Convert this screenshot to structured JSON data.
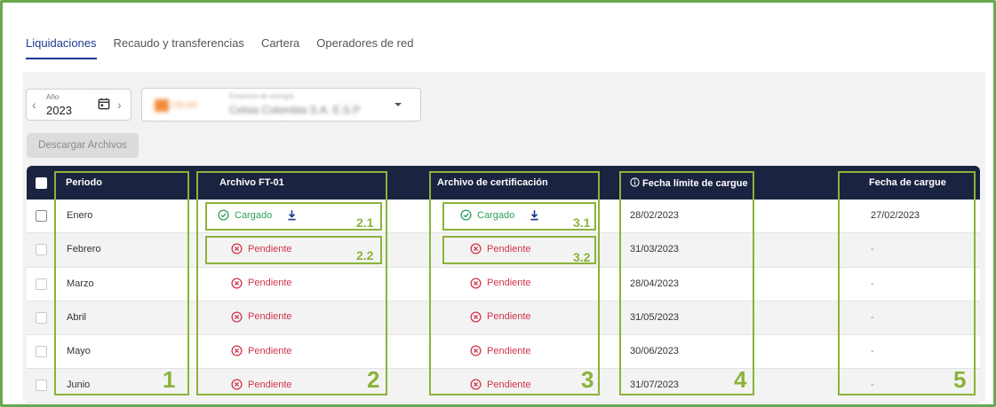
{
  "tabs": [
    {
      "label": "Liquidaciones",
      "active": true
    },
    {
      "label": "Recaudo y transferencias",
      "active": false
    },
    {
      "label": "Cartera",
      "active": false
    },
    {
      "label": "Operadores de red",
      "active": false
    }
  ],
  "filters": {
    "year_label": "Año",
    "year_value": "2023",
    "company_sub_label": "Empresa de energía",
    "company_name": "Celsia Colombia S.A. E.S.P",
    "company_logo_text": "CELSIA"
  },
  "actions": {
    "download_label": "Descargar Archivos"
  },
  "table": {
    "headers": {
      "periodo": "Periodo",
      "archivo_ft01": "Archivo FT-01",
      "archivo_cert": "Archivo de certificación",
      "fecha_limite": "Fecha límite de cargue",
      "fecha_cargue": "Fecha de cargue"
    },
    "rows": [
      {
        "periodo": "Enero",
        "ft01": "Cargado",
        "cert": "Cargado",
        "fecha_limite": "28/02/2023",
        "fecha_cargue": "27/02/2023"
      },
      {
        "periodo": "Febrero",
        "ft01": "Pendiente",
        "cert": "Pendiente",
        "fecha_limite": "31/03/2023",
        "fecha_cargue": "-"
      },
      {
        "periodo": "Marzo",
        "ft01": "Pendiente",
        "cert": "Pendiente",
        "fecha_limite": "28/04/2023",
        "fecha_cargue": "-"
      },
      {
        "periodo": "Abril",
        "ft01": "Pendiente",
        "cert": "Pendiente",
        "fecha_limite": "31/05/2023",
        "fecha_cargue": "-"
      },
      {
        "periodo": "Mayo",
        "ft01": "Pendiente",
        "cert": "Pendiente",
        "fecha_limite": "30/06/2023",
        "fecha_cargue": "-"
      },
      {
        "periodo": "Junio",
        "ft01": "Pendiente",
        "cert": "Pendiente",
        "fecha_limite": "31/07/2023",
        "fecha_cargue": "-"
      }
    ]
  },
  "annotations": {
    "col1": "1",
    "col2": "2",
    "col3": "3",
    "col4": "4",
    "col5": "5",
    "c21": "2.1",
    "c22": "2.2",
    "c31": "3.1",
    "c32": "3.2"
  },
  "colors": {
    "accent": "#1f3a93",
    "header_bg": "#1a2340",
    "success": "#2e9e5b",
    "pending": "#d0344c",
    "annotation": "#8bb33a"
  },
  "icons": {
    "calendar": "calendar-icon",
    "check_circle": "check-circle-icon",
    "x_circle": "x-circle-icon",
    "download": "download-icon",
    "info": "info-icon",
    "caret": "caret-down-icon"
  }
}
